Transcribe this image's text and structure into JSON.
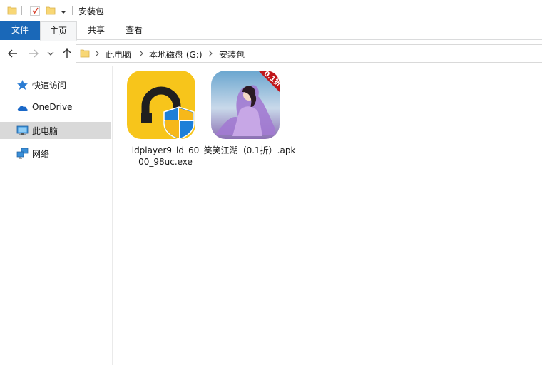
{
  "window": {
    "title": "安装包"
  },
  "ribbon": {
    "tabs": [
      {
        "label": "文件"
      },
      {
        "label": "主页"
      },
      {
        "label": "共享"
      },
      {
        "label": "查看"
      }
    ]
  },
  "address": {
    "crumbs": [
      "此电脑",
      "本地磁盘 (G:)",
      "安装包"
    ]
  },
  "sidebar": {
    "items": [
      {
        "label": "快速访问",
        "icon": "star-icon"
      },
      {
        "label": "OneDrive",
        "icon": "cloud-icon"
      },
      {
        "label": "此电脑",
        "icon": "computer-icon",
        "selected": true
      },
      {
        "label": "网络",
        "icon": "network-icon"
      }
    ]
  },
  "files": [
    {
      "name_line1": "ldplayer9_ld_60",
      "name_line2": "00_98uc.exe",
      "icon": "ldplayer-icon"
    },
    {
      "name_line1": "笑笑江湖（0.1折）.apk",
      "name_line2": "",
      "icon": "game-apk-icon",
      "badge": "0.1折"
    }
  ],
  "colors": {
    "accent": "#1a68b8",
    "selected_bg": "#d9d9d9",
    "folder": "#f8d775"
  }
}
